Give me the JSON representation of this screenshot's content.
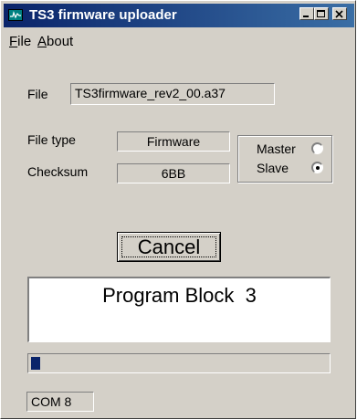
{
  "window": {
    "title": "TS3 firmware uploader",
    "controls": [
      "minimize",
      "maximize",
      "close"
    ]
  },
  "menu": {
    "items": [
      {
        "first": "F",
        "rest": "ile"
      },
      {
        "first": "A",
        "rest": "bout"
      }
    ]
  },
  "file": {
    "label": "File",
    "value": "TS3firmware_rev2_00.a37"
  },
  "file_type": {
    "label": "File type",
    "value": "Firmware"
  },
  "checksum": {
    "label": "Checksum",
    "value": "6BB"
  },
  "mode": {
    "options": [
      {
        "label": "Master",
        "selected": false
      },
      {
        "label": "Slave",
        "selected": true
      }
    ]
  },
  "actions": {
    "cancel_label": "Cancel"
  },
  "status": {
    "message": "Program Block  3"
  },
  "progress": {
    "fraction": 0.03
  },
  "port": {
    "value": "COM 8"
  }
}
